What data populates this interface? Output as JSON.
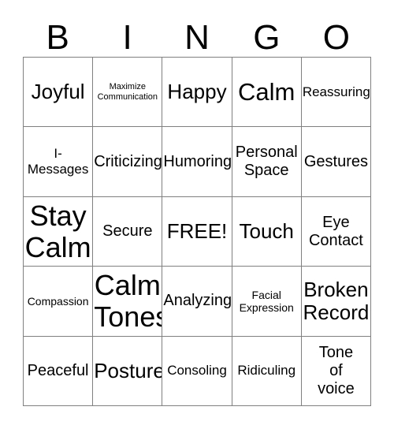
{
  "card": {
    "title_letters": [
      "B",
      "I",
      "N",
      "G",
      "O"
    ],
    "free_space_label": "FREE!",
    "border_color": "#808080",
    "text_color": "#000000",
    "background_color": "#ffffff",
    "rows": 5,
    "columns": 5
  },
  "grid": [
    [
      {
        "label": "Joyful",
        "size": "xl",
        "lines": 1
      },
      {
        "label": "Maximize\nCommunication",
        "size": "xs",
        "lines": 2
      },
      {
        "label": "Happy",
        "size": "xl",
        "lines": 1
      },
      {
        "label": "Calm",
        "size": "xxl",
        "lines": 1
      },
      {
        "label": "Reassuring",
        "size": "m",
        "lines": 1
      }
    ],
    [
      {
        "label": "I-\nMessages",
        "size": "m",
        "lines": 2
      },
      {
        "label": "Criticizing",
        "size": "l",
        "lines": 1
      },
      {
        "label": "Humoring",
        "size": "l",
        "lines": 1
      },
      {
        "label": "Personal\nSpace",
        "size": "l",
        "lines": 2
      },
      {
        "label": "Gestures",
        "size": "l",
        "lines": 1
      }
    ],
    [
      {
        "label": "Stay\nCalm",
        "size": "huge",
        "lines": 2
      },
      {
        "label": "Secure",
        "size": "l",
        "lines": 1
      },
      {
        "label": "FREE!",
        "size": "xl",
        "lines": 1
      },
      {
        "label": "Touch",
        "size": "xl",
        "lines": 1
      },
      {
        "label": "Eye\nContact",
        "size": "l",
        "lines": 2
      }
    ],
    [
      {
        "label": "Compassion",
        "size": "s",
        "lines": 1
      },
      {
        "label": "Calm\nTones",
        "size": "huge",
        "lines": 2
      },
      {
        "label": "Analyzing",
        "size": "l",
        "lines": 1
      },
      {
        "label": "Facial\nExpression",
        "size": "s",
        "lines": 2
      },
      {
        "label": "Broken\nRecord",
        "size": "xl",
        "lines": 2
      }
    ],
    [
      {
        "label": "Peaceful",
        "size": "l",
        "lines": 1
      },
      {
        "label": "Posture",
        "size": "xl",
        "lines": 1
      },
      {
        "label": "Consoling",
        "size": "m",
        "lines": 1
      },
      {
        "label": "Ridiculing",
        "size": "m",
        "lines": 1
      },
      {
        "label": "Tone\nof\nvoice",
        "size": "l",
        "lines": 3
      }
    ]
  ]
}
